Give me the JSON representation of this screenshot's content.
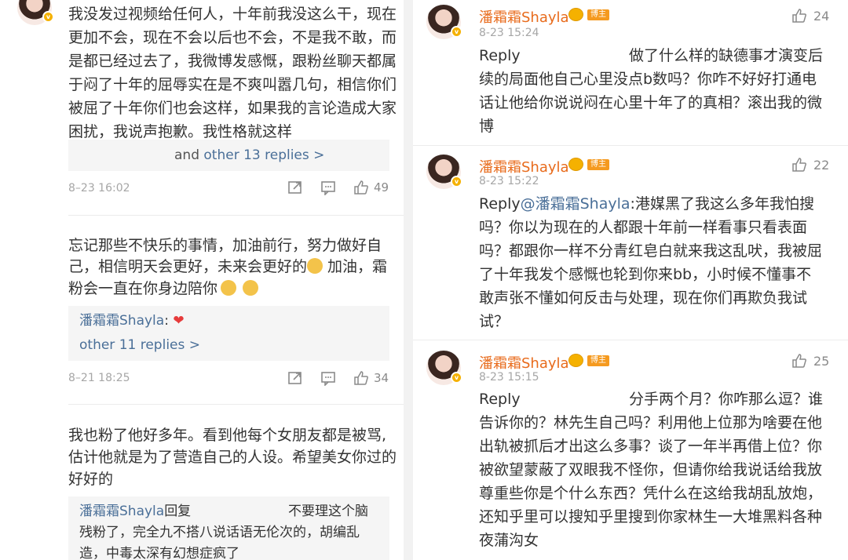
{
  "left": {
    "c1": {
      "lines": [
        "我没发过视频给任何人，十年前我没这么干，现在",
        "更加不会，现在不会以后也不会，不是我不敢，而",
        "是都已经过去了，我微博发感慨，跟粉丝聊天都属",
        "于闷了十年的屈辱实在是不爽叫嚣几句，相信你们",
        "被屈了十年你们也会这样，如果我的言论造成大家",
        "困扰，我说声抱歉。我性格就这样"
      ],
      "replies_prefix": "and",
      "replies_link": "other 13 replies >",
      "date": "8–23 16:02",
      "likes": "49"
    },
    "c2": {
      "lines": [
        "忘记那些不快乐的事情，加油前行，努力做好自",
        "己，相信明天会更好，未来会更好的",
        " 加油，霜",
        "粉会一直在你身边陪你"
      ],
      "reply_author": "潘霜霜Shayla",
      "reply_colon": ":",
      "heart": "❤",
      "replies_link": "other 11 replies >",
      "date": "8–21 18:25",
      "likes": "34"
    },
    "c3": {
      "lines": [
        "我也粉了他好多年。看到他每个女朋友都是被骂,",
        "估计他就是为了营造自己的人设。希望美女你过的",
        "好好的"
      ],
      "reply_author": "潘霜霜Shayla",
      "reply_verb": "回复",
      "reply_lines": [
        "不要理这个脑",
        "残粉了，完全九不搭八说话语无伦次的，胡编乱",
        "造，中毒太深有幻想症疯了"
      ]
    }
  },
  "right": {
    "badge_label": "博主",
    "r1": {
      "name": "潘霜霜Shayla",
      "date": "8-23 15:24",
      "likes": "24",
      "reply_word": "Reply",
      "lines": [
        "做了什么样的缺德事才演变后",
        "续的局面他自己心里没点b数吗？你咋不好好打通电",
        "话让他给你说说闷在心里十年了的真相？滚出我的微",
        "博"
      ]
    },
    "r2": {
      "name": "潘霜霜Shayla",
      "date": "8-23 15:22",
      "likes": "22",
      "reply_word": "Reply",
      "mention": "@潘霜霜Shayla",
      "lines": [
        ":港媒黑了我这么多年我怕搜",
        "吗？你以为现在的人都跟十年前一样看事只看表面",
        "吗？都跟你一样不分青红皂白就来我这乱吠，我被屈",
        "了十年我发个感慨也轮到你来bb，小时候不懂事不",
        "敢声张不懂如何反击与处理，现在你们再欺负我试",
        "试？"
      ]
    },
    "r3": {
      "name": "潘霜霜Shayla",
      "date": "8-23 15:15",
      "likes": "25",
      "reply_word": "Reply",
      "lines": [
        "分手两个月？你咋那么逗？谁",
        "告诉你的？林先生自己吗？利用他上位那为啥要在他",
        "出轨被抓后才出这么多事？谈了一年半再借上位？你",
        "被欲望蒙蔽了双眼我不怪你，但请你给我说话给我放",
        "尊重些你是个什么东西？凭什么在这给我胡乱放炮，",
        "还知乎里可以搜知乎里搜到你家林生一大堆黑料各种",
        "夜蒲沟女"
      ]
    }
  }
}
